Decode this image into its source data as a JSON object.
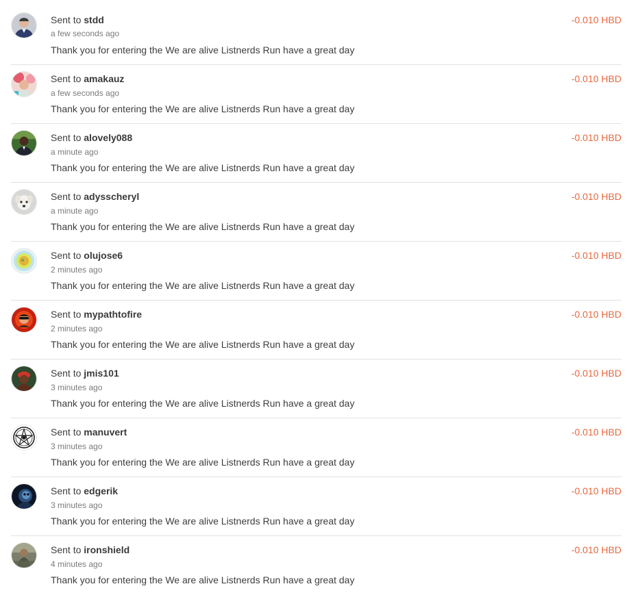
{
  "transfers": [
    {
      "prefix": "Sent to",
      "user": "stdd",
      "time": "a few seconds ago",
      "memo": "Thank you for entering the We are alive Listnerds Run have a great day",
      "amount": "-0.010 HBD",
      "avatar_icon": "user-avatar-stdd-icon"
    },
    {
      "prefix": "Sent to",
      "user": "amakauz",
      "time": "a few seconds ago",
      "memo": "Thank you for entering the We are alive Listnerds Run have a great day",
      "amount": "-0.010 HBD",
      "avatar_icon": "user-avatar-amakauz-icon"
    },
    {
      "prefix": "Sent to",
      "user": "alovely088",
      "time": "a minute ago",
      "memo": "Thank you for entering the We are alive Listnerds Run have a great day",
      "amount": "-0.010 HBD",
      "avatar_icon": "user-avatar-alovely088-icon"
    },
    {
      "prefix": "Sent to",
      "user": "adysscheryl",
      "time": "a minute ago",
      "memo": "Thank you for entering the We are alive Listnerds Run have a great day",
      "amount": "-0.010 HBD",
      "avatar_icon": "user-avatar-adysscheryl-icon"
    },
    {
      "prefix": "Sent to",
      "user": "olujose6",
      "time": "2 minutes ago",
      "memo": "Thank you for entering the We are alive Listnerds Run have a great day",
      "amount": "-0.010 HBD",
      "avatar_icon": "user-avatar-olujose6-icon"
    },
    {
      "prefix": "Sent to",
      "user": "mypathtofire",
      "time": "2 minutes ago",
      "memo": "Thank you for entering the We are alive Listnerds Run have a great day",
      "amount": "-0.010 HBD",
      "avatar_icon": "user-avatar-mypathtofire-icon"
    },
    {
      "prefix": "Sent to",
      "user": "jmis101",
      "time": "3 minutes ago",
      "memo": "Thank you for entering the We are alive Listnerds Run have a great day",
      "amount": "-0.010 HBD",
      "avatar_icon": "user-avatar-jmis101-icon"
    },
    {
      "prefix": "Sent to",
      "user": "manuvert",
      "time": "3 minutes ago",
      "memo": "Thank you for entering the We are alive Listnerds Run have a great day",
      "amount": "-0.010 HBD",
      "avatar_icon": "user-avatar-manuvert-icon"
    },
    {
      "prefix": "Sent to",
      "user": "edgerik",
      "time": "3 minutes ago",
      "memo": "Thank you for entering the We are alive Listnerds Run have a great day",
      "amount": "-0.010 HBD",
      "avatar_icon": "user-avatar-edgerik-icon"
    },
    {
      "prefix": "Sent to",
      "user": "ironshield",
      "time": "4 minutes ago",
      "memo": "Thank you for entering the We are alive Listnerds Run have a great day",
      "amount": "-0.010 HBD",
      "avatar_icon": "user-avatar-ironshield-icon"
    }
  ],
  "colors": {
    "amount": "#e8683f",
    "divider": "#e2e2e2",
    "text": "#3d3d3d",
    "muted": "#7a7a7a"
  }
}
